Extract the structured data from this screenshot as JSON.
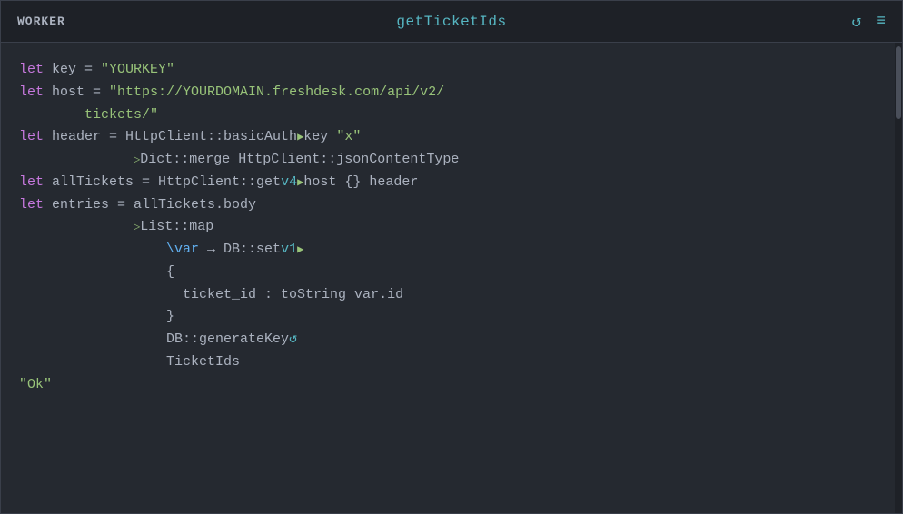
{
  "header": {
    "worker_label": "WORKER",
    "title": "getTicketIds",
    "refresh_icon": "↺",
    "menu_icon": "≡"
  },
  "code": {
    "lines": [
      {
        "id": "line1",
        "tokens": [
          {
            "t": "kw",
            "v": "let"
          },
          {
            "t": "plain",
            "v": " key = "
          },
          {
            "t": "str",
            "v": "\"YOURKEY\""
          }
        ]
      },
      {
        "id": "line2",
        "tokens": [
          {
            "t": "kw",
            "v": "let"
          },
          {
            "t": "plain",
            "v": " host = "
          },
          {
            "t": "str",
            "v": "\"https://YOURDOMAIN.freshdesk.com/api/v2/"
          }
        ]
      },
      {
        "id": "line2b",
        "tokens": [
          {
            "t": "plain",
            "v": "        "
          },
          {
            "t": "str",
            "v": "tickets/\""
          }
        ]
      },
      {
        "id": "line3",
        "tokens": [
          {
            "t": "kw",
            "v": "let"
          },
          {
            "t": "plain",
            "v": " header = HttpClient::basicAuth"
          },
          {
            "t": "tri",
            "v": "▶"
          },
          {
            "t": "plain",
            "v": "key "
          },
          {
            "t": "str",
            "v": "\"x\""
          }
        ]
      },
      {
        "id": "line3b",
        "tokens": [
          {
            "t": "plain",
            "v": "              "
          },
          {
            "t": "tri",
            "v": "▷"
          },
          {
            "t": "plain",
            "v": "Dict::merge HttpClient::jsonContentType"
          }
        ]
      },
      {
        "id": "line4",
        "tokens": [
          {
            "t": "kw",
            "v": "let"
          },
          {
            "t": "plain",
            "v": " allTickets = HttpClient::get"
          },
          {
            "t": "special",
            "v": "v4"
          },
          {
            "t": "tri",
            "v": "▶"
          },
          {
            "t": "plain",
            "v": "host {} header"
          }
        ]
      },
      {
        "id": "line5",
        "tokens": [
          {
            "t": "kw",
            "v": "let"
          },
          {
            "t": "plain",
            "v": " entries = allTickets.body"
          }
        ]
      },
      {
        "id": "line5b",
        "tokens": [
          {
            "t": "plain",
            "v": "              "
          },
          {
            "t": "tri",
            "v": "▷"
          },
          {
            "t": "plain",
            "v": "List::map"
          }
        ]
      },
      {
        "id": "line6",
        "tokens": [
          {
            "t": "plain",
            "v": "                  "
          },
          {
            "t": "fn",
            "v": "\\var"
          },
          {
            "t": "plain",
            "v": " → DB::set"
          },
          {
            "t": "special",
            "v": "v1"
          },
          {
            "t": "tri",
            "v": "▶"
          }
        ]
      },
      {
        "id": "line7",
        "tokens": [
          {
            "t": "plain",
            "v": "                  {"
          }
        ]
      },
      {
        "id": "line8",
        "tokens": [
          {
            "t": "plain",
            "v": "                    ticket_id : toString var.id"
          }
        ]
      },
      {
        "id": "line9",
        "tokens": [
          {
            "t": "plain",
            "v": "                  }"
          }
        ]
      },
      {
        "id": "line10",
        "tokens": [
          {
            "t": "plain",
            "v": "                  DB::generateKey"
          },
          {
            "t": "rotate-icon",
            "v": "↺"
          }
        ]
      },
      {
        "id": "line11",
        "tokens": [
          {
            "t": "plain",
            "v": "                  TicketIds"
          }
        ]
      },
      {
        "id": "line12",
        "tokens": [
          {
            "t": "str",
            "v": "\"Ok\""
          }
        ]
      }
    ]
  }
}
